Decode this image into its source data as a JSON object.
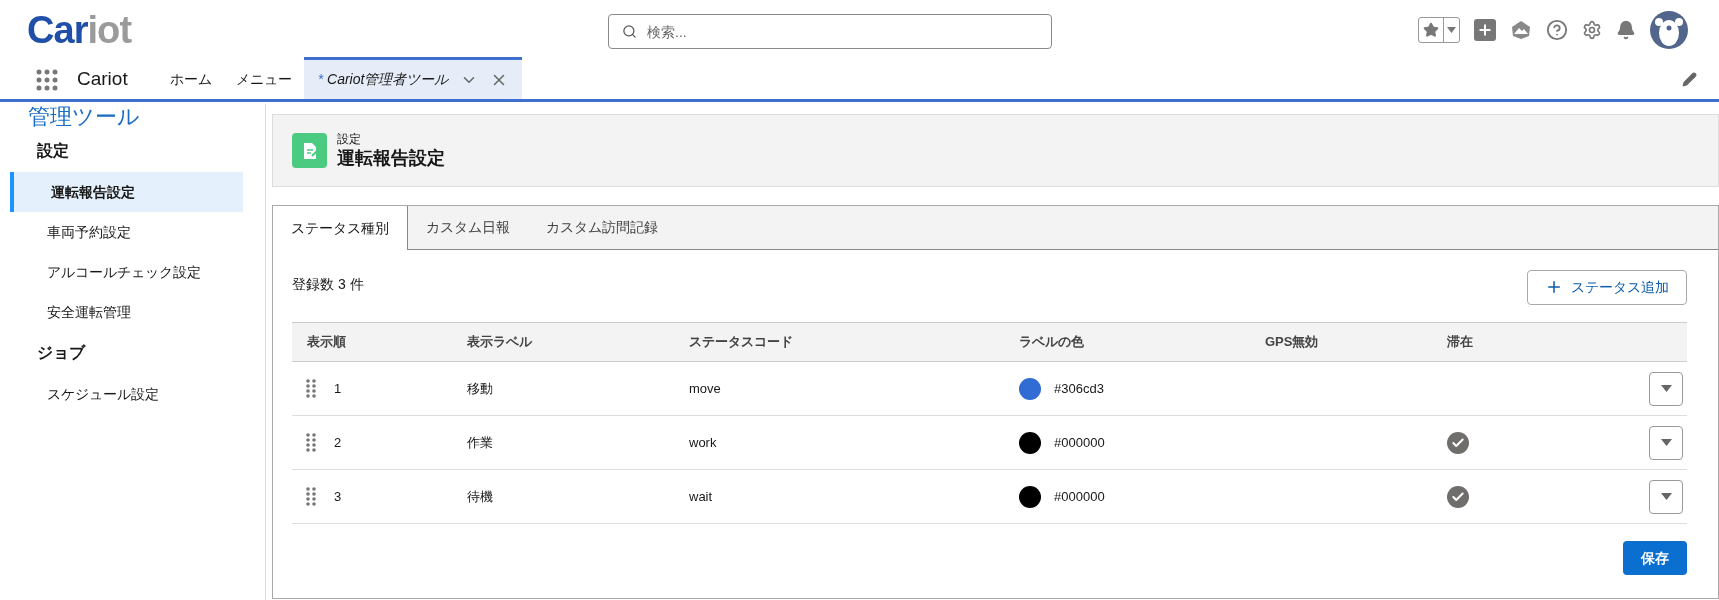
{
  "header": {
    "logo": {
      "primary": "Car",
      "secondary": "iot"
    },
    "search": {
      "placeholder": "検索..."
    }
  },
  "nav": {
    "app_name": "Cariot",
    "items": [
      {
        "label": "ホーム",
        "selected": false,
        "kind": "link"
      },
      {
        "label": "メニュー",
        "selected": false,
        "kind": "link"
      },
      {
        "label": "Cariot管理者ツール",
        "marker": "*",
        "selected": true,
        "kind": "tab"
      }
    ]
  },
  "sidebar": {
    "title": "管理ツール",
    "sections": [
      {
        "heading": "設定",
        "items": [
          {
            "label": "運転報告設定",
            "selected": true
          },
          {
            "label": "車両予約設定",
            "selected": false
          },
          {
            "label": "アルコールチェック設定",
            "selected": false
          },
          {
            "label": "安全運転管理",
            "selected": false
          }
        ]
      },
      {
        "heading": "ジョブ",
        "items": [
          {
            "label": "スケジュール設定",
            "selected": false
          }
        ]
      }
    ]
  },
  "page_header": {
    "overline": "設定",
    "title": "運転報告設定"
  },
  "tabs": [
    {
      "label": "ステータス種別",
      "selected": true
    },
    {
      "label": "カスタム日報",
      "selected": false
    },
    {
      "label": "カスタム訪問記録",
      "selected": false
    }
  ],
  "count_text": "登録数 3 件",
  "add_button": "ステータス追加",
  "table": {
    "columns": [
      "表示順",
      "表示ラベル",
      "ステータスコード",
      "ラベルの色",
      "GPS無効",
      "滞在"
    ],
    "rows": [
      {
        "order": "1",
        "label": "移動",
        "code": "move",
        "color": "#306cd3",
        "color_text": "#306cd3",
        "stay": false
      },
      {
        "order": "2",
        "label": "作業",
        "code": "work",
        "color": "#000000",
        "color_text": "#000000",
        "stay": true
      },
      {
        "order": "3",
        "label": "待機",
        "code": "wait",
        "color": "#000000",
        "color_text": "#000000",
        "stay": true
      }
    ]
  },
  "save_button": "保存"
}
